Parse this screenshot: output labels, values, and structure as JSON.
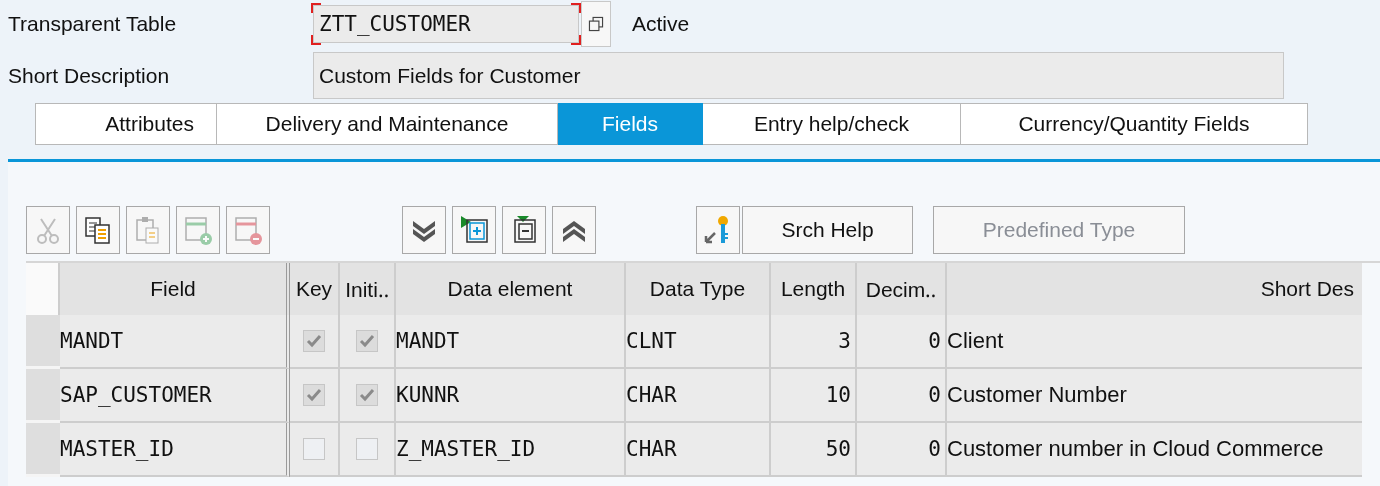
{
  "header": {
    "table_label": "Transparent Table",
    "table_name": "ZTT_CUSTOMER",
    "table_name_focused": true,
    "status": "Active",
    "description_label": "Short Description",
    "description": "Custom Fields for Customer"
  },
  "tabs": [
    {
      "label": "Attributes",
      "selected": false
    },
    {
      "label": "Delivery and Maintenance",
      "selected": false
    },
    {
      "label": "Fields",
      "selected": true
    },
    {
      "label": "Entry help/check",
      "selected": false
    },
    {
      "label": "Currency/Quantity Fields",
      "selected": false
    }
  ],
  "toolbar": {
    "icon_buttons": [
      {
        "disabled": true
      },
      {
        "disabled": false
      },
      {
        "disabled": true
      },
      {
        "disabled": true
      },
      {
        "disabled": true
      },
      {
        "disabled": false
      },
      {
        "disabled": false
      },
      {
        "disabled": false
      },
      {
        "disabled": false
      },
      {
        "disabled": false
      }
    ],
    "text_buttons": [
      {
        "label": "Srch Help",
        "disabled": false
      },
      {
        "label": "Predefined Type",
        "disabled": true
      }
    ]
  },
  "table": {
    "columns": [
      "Field",
      "Key",
      "Initi‥",
      "Data element",
      "Data Type",
      "Length",
      "Decim‥",
      "Short Des"
    ],
    "rows": [
      {
        "field": "MANDT",
        "key": true,
        "initial": true,
        "data_element": "MANDT",
        "data_type": "CLNT",
        "length": "3",
        "decimals": "0",
        "short_description": "Client"
      },
      {
        "field": "SAP_CUSTOMER",
        "key": true,
        "initial": true,
        "data_element": "KUNNR",
        "data_type": "CHAR",
        "length": "10",
        "decimals": "0",
        "short_description": "Customer Number"
      },
      {
        "field": "MASTER_ID",
        "key": false,
        "initial": false,
        "data_element": "Z_MASTER_ID",
        "data_type": "CHAR",
        "length": "50",
        "decimals": "0",
        "short_description": "Customer number in Cloud Commerce"
      }
    ]
  }
}
